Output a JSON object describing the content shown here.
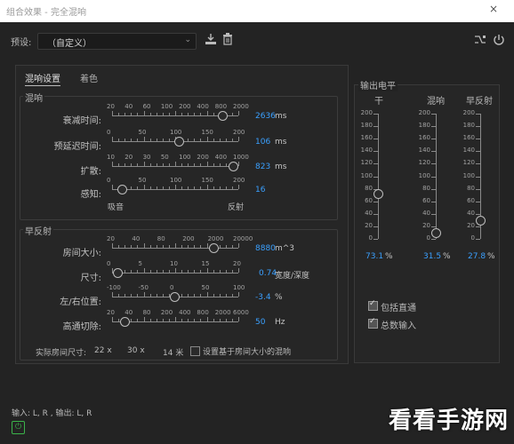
{
  "window": {
    "title": "组合效果 - 完全混响",
    "close": "×"
  },
  "preset": {
    "label": "预设:",
    "value": "（自定义）"
  },
  "tabs": [
    "混响设置",
    "着色"
  ],
  "reverb": {
    "group_title": "混响",
    "rows": [
      {
        "label": "衰减时间:",
        "ticks": [
          "20",
          "40",
          "60",
          "100",
          "200",
          "400",
          "800",
          "2000"
        ],
        "value": "2636",
        "unit": "ms",
        "knob": 0.87
      },
      {
        "label": "预延迟时间:",
        "ticks": [
          "0",
          "50",
          "100",
          "150",
          "200"
        ],
        "value": "106",
        "unit": "ms",
        "knob": 0.53
      },
      {
        "label": "扩散:",
        "ticks": [
          "10",
          "20",
          "30",
          "50",
          "100",
          "200",
          "400",
          "1000"
        ],
        "value": "823",
        "unit": "ms",
        "knob": 0.96
      },
      {
        "label": "感知:",
        "ticks": [
          "0",
          "50",
          "100",
          "150",
          "200"
        ],
        "value": "16",
        "unit": "",
        "knob": 0.08
      }
    ],
    "perception_ends": [
      "吸音",
      "反射"
    ]
  },
  "early": {
    "group_title": "早反射",
    "rows": [
      {
        "label": "房间大小:",
        "ticks": [
          "20",
          "40",
          "80",
          "200",
          "2000",
          "20000"
        ],
        "value": "8880",
        "unit": "m^3",
        "knob": 0.8
      },
      {
        "label": "尺寸:",
        "ticks": [
          "0",
          "5",
          "10",
          "15",
          "20"
        ],
        "value": "0.74",
        "unit": "宽度/深度",
        "knob": 0.04
      },
      {
        "label": "左/右位置:",
        "ticks": [
          "-100",
          "-50",
          "0",
          "50",
          "100"
        ],
        "value": "-3.4",
        "unit": "%",
        "knob": 0.49
      },
      {
        "label": "高通切除:",
        "ticks": [
          "20",
          "40",
          "80",
          "200",
          "400",
          "800",
          "2000",
          "6000"
        ],
        "value": "50",
        "unit": "Hz",
        "knob": 0.1
      }
    ],
    "room_size_label": "实际房间尺寸:",
    "dims": [
      "22 x",
      "30 x",
      "14 米"
    ],
    "set_by_room_label": "设置基于房间大小的混响"
  },
  "output": {
    "title": "输出电平",
    "scale": [
      "200",
      "180",
      "160",
      "140",
      "120",
      "100",
      "80",
      "60",
      "40",
      "20",
      "0"
    ],
    "channels": [
      {
        "name": "干",
        "value": "73.1",
        "unit": "%",
        "level": 0.365
      },
      {
        "name": "混响",
        "value": "31.5",
        "unit": "%",
        "level": 0.05
      },
      {
        "name": "早反射",
        "value": "27.8",
        "unit": "%",
        "level": 0.15
      }
    ],
    "checkboxes": [
      {
        "label": "包括直通",
        "checked": true
      },
      {
        "label": "总数输入",
        "checked": true
      }
    ]
  },
  "footer": {
    "io": "输入: L, R , 输出: L, R"
  },
  "watermark": "看看手游网",
  "colors": {
    "accent": "#3aa0ff",
    "bg": "#232323",
    "panel": "#262626"
  }
}
